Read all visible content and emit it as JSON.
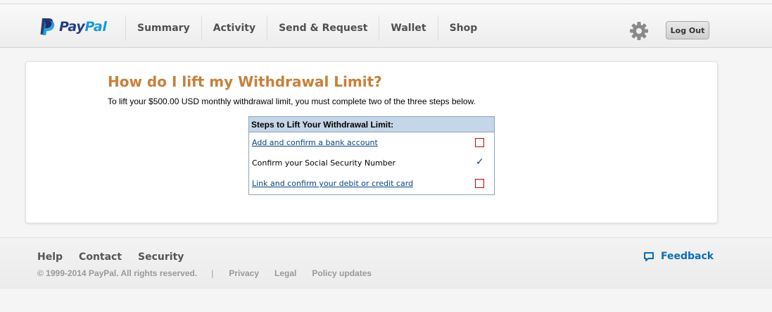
{
  "brand": {
    "name_part1": "Pay",
    "name_part2": "Pal",
    "dark_blue": "#253b80",
    "light_blue": "#179bd7",
    "icon": "paypal-logo-icon"
  },
  "nav": {
    "items": [
      {
        "label": "Summary"
      },
      {
        "label": "Activity"
      },
      {
        "label": "Send & Request"
      },
      {
        "label": "Wallet"
      },
      {
        "label": "Shop"
      }
    ],
    "settings_icon": "gear-icon",
    "logout_label": "Log Out"
  },
  "main": {
    "title": "How do I lift my Withdrawal Limit?",
    "title_color": "#c8803a",
    "intro": "To lift your $500.00 USD monthly withdrawal limit, you must complete two of the three steps below.",
    "steps_header": "Steps to Lift Your Withdrawal Limit:",
    "steps": [
      {
        "label": "Add and confirm a bank account",
        "is_link": true,
        "status": "incomplete"
      },
      {
        "label": "Confirm your Social Security Number",
        "is_link": false,
        "status": "complete"
      },
      {
        "label": "Link and confirm your debit or credit card",
        "is_link": true,
        "status": "incomplete"
      }
    ]
  },
  "footer": {
    "links": [
      "Help",
      "Contact",
      "Security"
    ],
    "copyright": "© 1999-2014 PayPal. All rights reserved.",
    "separator": "|",
    "legal_links": [
      "Privacy",
      "Legal",
      "Policy updates"
    ],
    "feedback_label": "Feedback",
    "feedback_icon": "speech-bubble-icon"
  }
}
